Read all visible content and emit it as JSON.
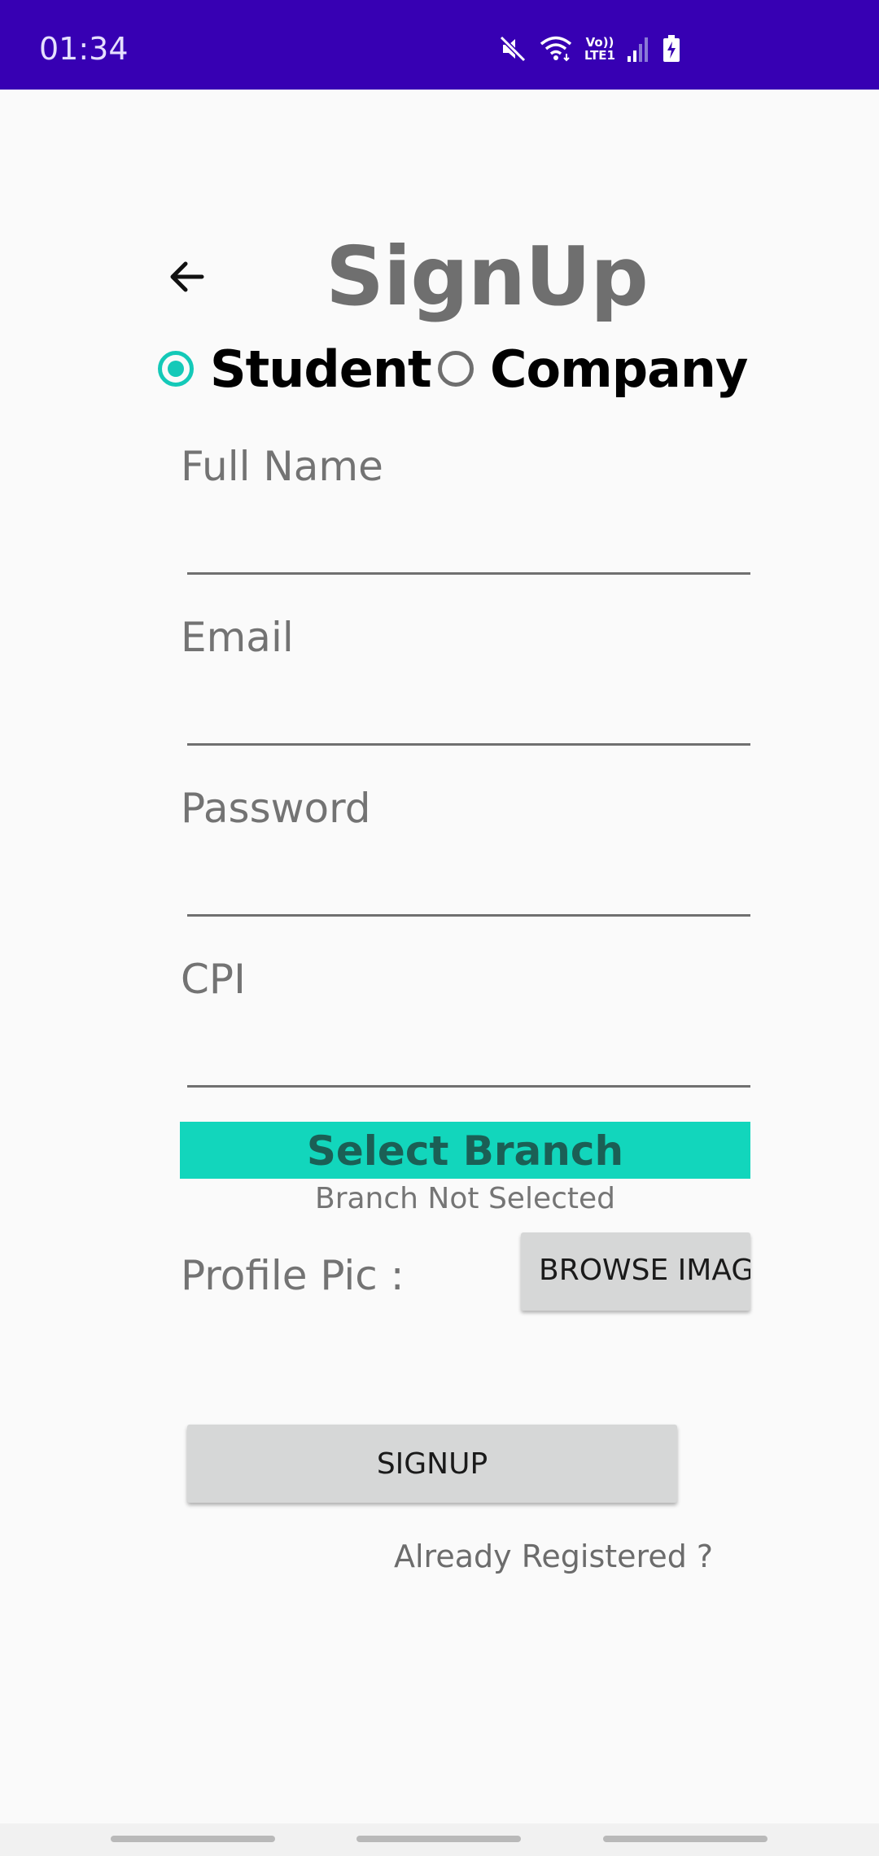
{
  "status_bar": {
    "time": "01:34",
    "lte_top": "Vo))",
    "lte_bottom": "LTE1",
    "icons": [
      "mute-icon",
      "wifi-icon",
      "lte-icon",
      "signal-icon",
      "battery-charging-icon"
    ]
  },
  "header": {
    "back_icon": "arrow-left-icon",
    "title": "SignUp"
  },
  "user_type": {
    "options": [
      {
        "label": "Student",
        "checked": true
      },
      {
        "label": "Company",
        "checked": false
      }
    ]
  },
  "form": {
    "full_name_label": "Full Name",
    "full_name_value": "",
    "email_label": "Email",
    "email_value": "",
    "password_label": "Password",
    "password_value": "",
    "cpi_label": "CPI",
    "cpi_value": "",
    "select_branch_label": "Select Branch",
    "branch_status": "Branch Not Selected",
    "profile_pic_label": "Profile Pic :",
    "browse_image_label": "BROWSE IMAGE",
    "signup_label": "SIGNUP",
    "already_registered_label": "Already Registered ?"
  },
  "colors": {
    "status_bar": "#3700b3",
    "accent": "#14c9b8",
    "select_branch_bg": "#12d6bc",
    "select_branch_text": "#1b5f55",
    "button_bg": "#d6d7d7"
  }
}
